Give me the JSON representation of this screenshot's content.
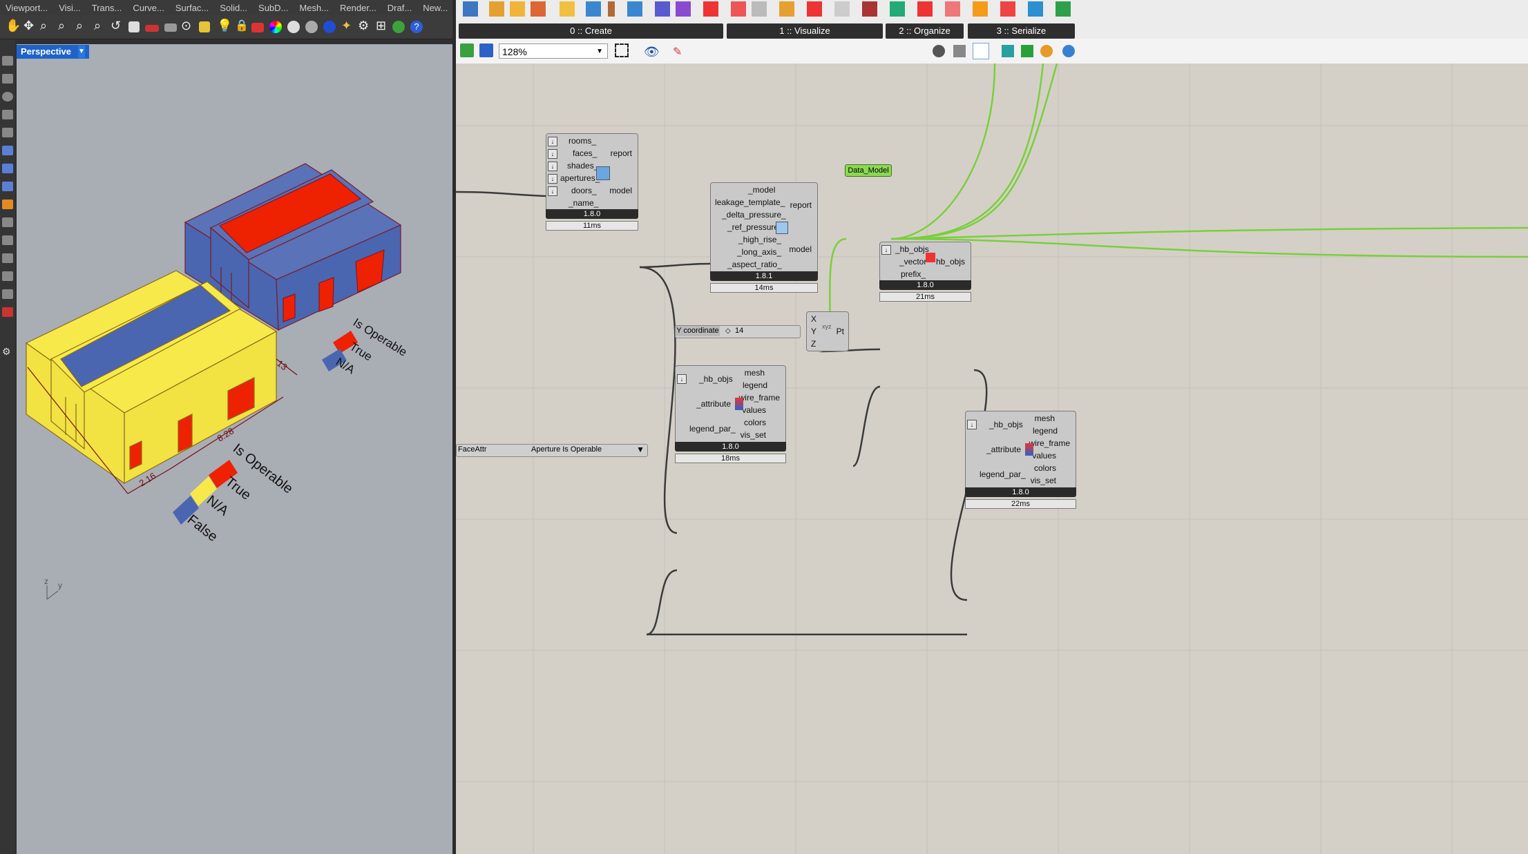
{
  "rhino": {
    "menu_tabs": [
      "Viewport...",
      "Visi...",
      "Trans...",
      "Curve...",
      "Surfac...",
      "Solid...",
      "SubD...",
      "Mesh...",
      "Render...",
      "Draf...",
      "New..."
    ],
    "viewport_label": "Perspective",
    "dimensions": {
      "d1": "2.16",
      "d2": "8.28",
      "d3": "13"
    },
    "legend_back": {
      "title": "Is Operable",
      "entries": [
        "True",
        "N/A"
      ]
    },
    "legend_front": {
      "title": "Is Operable",
      "entries": [
        "True",
        "N/A",
        "False"
      ]
    },
    "axis": {
      "z": "z",
      "y": "y"
    },
    "colors": {
      "red": "#ee2200",
      "blue": "#4a66b0",
      "yellow": "#f7e94a"
    }
  },
  "gh": {
    "ribbon_tabs": [
      "0 :: Create",
      "1 :: Visualize",
      "2 :: Organize",
      "3 :: Serialize"
    ],
    "zoom": "128%",
    "model_comp": {
      "inputs": [
        "rooms_",
        "faces_",
        "shades_",
        "apertures_",
        "doors_",
        "_name_"
      ],
      "outputs": [
        "report",
        "model"
      ],
      "version": "1.8.0",
      "time": "11ms"
    },
    "leak_comp": {
      "inputs": [
        "_model",
        "leakage_template_",
        "_delta_pressure_",
        "_ref_pressure_",
        "_high_rise_",
        "_long_axis_",
        "_aspect_ratio_"
      ],
      "outputs": [
        "report",
        "model"
      ],
      "version": "1.8.1",
      "time": "14ms"
    },
    "data_model": "Data_Model",
    "move_comp": {
      "inputs": [
        "_hb_objs",
        "_vector",
        "prefix_"
      ],
      "outputs": [
        "hb_objs"
      ],
      "version": "1.8.0",
      "time": "21ms"
    },
    "pt_comp": {
      "inputs": [
        "X",
        "Y",
        "Z"
      ],
      "outputs": [
        "Pt"
      ]
    },
    "slider": {
      "label": "Y coordinate",
      "value": "14"
    },
    "facevis1": {
      "inputs": [
        "_hb_objs",
        "_attribute",
        "legend_par_"
      ],
      "outputs": [
        "mesh",
        "legend",
        "wire_frame",
        "values",
        "colors",
        "vis_set"
      ],
      "version": "1.8.0",
      "time": "18ms"
    },
    "facevis2": {
      "inputs": [
        "_hb_objs",
        "_attribute",
        "legend_par_"
      ],
      "outputs": [
        "mesh",
        "legend",
        "wire_frame",
        "values",
        "colors",
        "vis_set"
      ],
      "version": "1.8.0",
      "time": "22ms"
    },
    "faceattr": {
      "label": "FaceAttr",
      "value": "Aperture Is Operable"
    }
  }
}
